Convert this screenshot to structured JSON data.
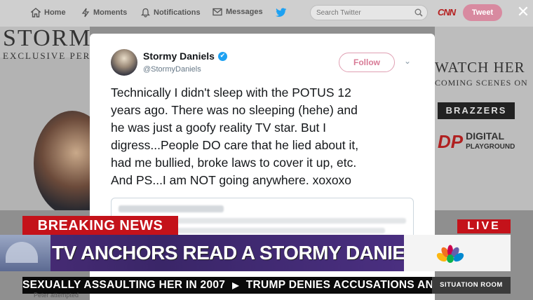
{
  "navbar": {
    "items": [
      {
        "label": "Home",
        "icon": "home-icon"
      },
      {
        "label": "Moments",
        "icon": "lightning-icon"
      },
      {
        "label": "Notifications",
        "icon": "bell-icon"
      },
      {
        "label": "Messages",
        "icon": "envelope-icon"
      }
    ],
    "search_placeholder": "Search Twitter",
    "network_logo": "CNN",
    "tweet_button": "Tweet",
    "close_label": "✕"
  },
  "background_profile": {
    "banner_title": "STORMY DANIELS",
    "banner_subtitle": "EXCLUSIVE PERFORMER",
    "watch_text": "WATCH HER",
    "coming_text": "COMING SCENES ON",
    "brazzers_text": "BRAZZERS",
    "dp_mark": "DP",
    "dp_text_top": "DIGITAL",
    "dp_text_bottom": "PLAYGROUND"
  },
  "tweet": {
    "author_name": "Stormy Daniels",
    "author_handle": "@StormyDaniels",
    "verified_mark": "✔",
    "follow_label": "Follow",
    "menu_caret": "⌄",
    "text": "Technically I didn't sleep with the POTUS 12\nyears ago. There was no sleeping (hehe) and\nhe was just a goofy reality TV star.  But I\ndigress...People DO care that he lied about it,\nhad me bullied, broke laws to cover it up, etc.\nAnd PS...I am NOT going anywhere. xoxoxo"
  },
  "chyron": {
    "breaking_label": "BREAKING NEWS",
    "live_label": "LIVE",
    "headline": "TV ANCHORS READ A STORMY DANIELS TWEET",
    "ticker_left": "SEXUALLY ASSAULTING HER IN 2007",
    "ticker_right": "TRUMP DENIES ACCUSATIONS AN",
    "show_name": "SITUATION ROOM",
    "ghost_text": "Peter attempted"
  },
  "colors": {
    "breaking_red": "#c4121a",
    "headline_purple": "#3a2668",
    "twitter_blue": "#1da1f2",
    "follow_pink": "#d87a96"
  }
}
